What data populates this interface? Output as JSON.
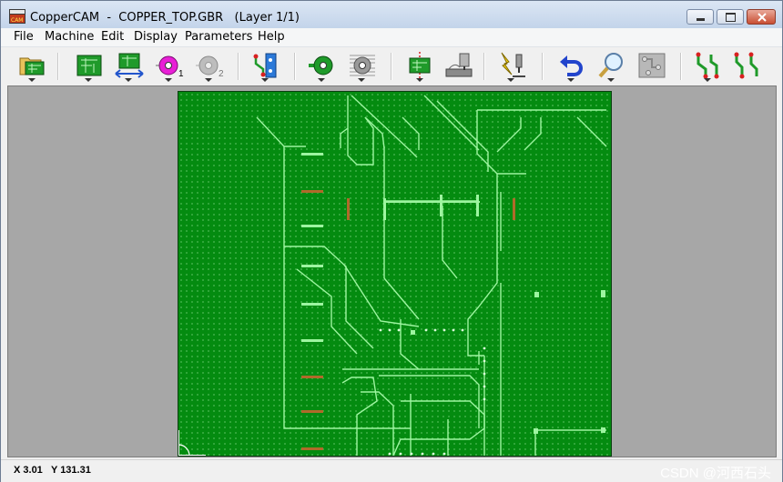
{
  "window": {
    "title": "CopperCAM  -  COPPER_TOP.GBR   (Layer 1/1)"
  },
  "menu": [
    "File",
    "Machine",
    "Edit",
    "Display",
    "Parameters",
    "Help"
  ],
  "toolbar": {
    "tools": [
      {
        "name": "open-file-icon"
      },
      {
        "name": "board-layers-icon"
      },
      {
        "name": "board-flip-icon"
      },
      {
        "name": "drill-1-icon",
        "label": "1"
      },
      {
        "name": "drill-2-icon",
        "label": "2"
      },
      {
        "name": "tracks-icon"
      },
      {
        "name": "pad-icon"
      },
      {
        "name": "pad-outline-icon"
      },
      {
        "name": "board-contour-icon"
      },
      {
        "name": "engraving-tool-icon"
      },
      {
        "name": "mill-spark-icon"
      },
      {
        "name": "undo-icon"
      },
      {
        "name": "zoom-icon"
      },
      {
        "name": "footprint-icon"
      },
      {
        "name": "path-1-icon"
      },
      {
        "name": "path-2-icon"
      }
    ]
  },
  "status": {
    "x_label": "X 3.01",
    "y_label": "Y 131.31"
  },
  "watermark": "CSDN @河西石头",
  "colors": {
    "board": "#048b10",
    "track": "#9df5a0",
    "pad_copper": "#b06a2a",
    "workspace": "#a7a7a7"
  }
}
